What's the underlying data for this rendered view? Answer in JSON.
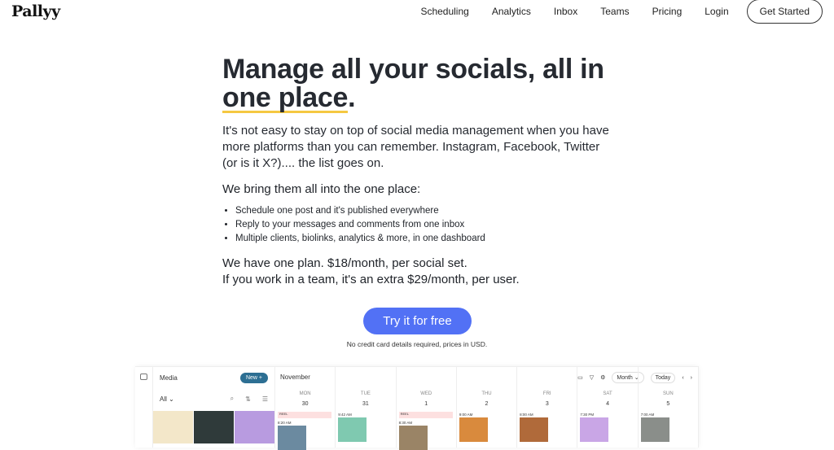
{
  "brand": "Pallyy",
  "nav": {
    "items": [
      "Scheduling",
      "Analytics",
      "Inbox",
      "Teams",
      "Pricing",
      "Login"
    ],
    "cta": "Get Started"
  },
  "hero": {
    "title_pre": "Manage all your socials, all in ",
    "title_highlight": "one place",
    "title_post": ".",
    "intro": "It's not easy to stay on top of social media management when you have more platforms than you can remember. Instagram, Facebook, Twitter (or is it X?).... the list goes on.",
    "subhead": "We bring them all into the one place:",
    "bullets": [
      "Schedule one post and it's published everywhere",
      "Reply to your messages and comments from one inbox",
      "Multiple clients, biolinks, analytics & more, in one dashboard"
    ],
    "plan1": "We have one plan. $18/month, per social set.",
    "plan2": "If you work in a team, it's an extra $29/month, per user.",
    "cta": "Try it for free",
    "note": "No credit card details required, prices in USD."
  },
  "app": {
    "media_title": "Media",
    "new_label": "New +",
    "filter": "All ⌄",
    "month": "November",
    "view": "Month ⌄",
    "today": "Today",
    "days": [
      {
        "d": "MON",
        "n": "30",
        "tag": "REEL",
        "time": "8:20 AM",
        "color": "#6b8aa0"
      },
      {
        "d": "TUE",
        "n": "31",
        "tag": "",
        "time": "9:42 AM",
        "color": "#7fc9b0"
      },
      {
        "d": "WED",
        "n": "1",
        "tag": "REEL",
        "time": "8:30 AM",
        "color": "#9a8466"
      },
      {
        "d": "THU",
        "n": "2",
        "tag": "",
        "time": "9:00 AM",
        "color": "#d98a3d"
      },
      {
        "d": "FRI",
        "n": "3",
        "tag": "",
        "time": "8:00 AM",
        "color": "#b06a3a"
      },
      {
        "d": "SAT",
        "n": "4",
        "tag": "",
        "time": "7:30 PM",
        "color": "#c9a6e6"
      },
      {
        "d": "SUN",
        "n": "5",
        "tag": "",
        "time": "7:00 AM",
        "color": "#8a8e8a"
      }
    ],
    "thumb_colors": [
      "#f3e7c9",
      "#2f3a3a",
      "#b89be0"
    ],
    "accent": "#5271f5"
  }
}
